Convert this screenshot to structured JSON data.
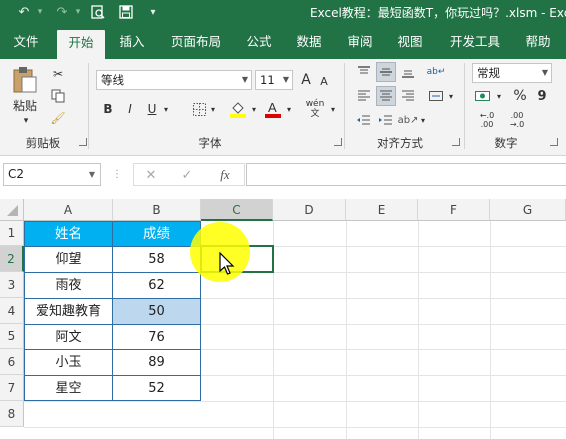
{
  "window": {
    "title": "Excel教程：最短函数T，你玩过吗？.xlsm - Exc"
  },
  "quick_access": {
    "undo": "↶",
    "redo": "↷",
    "print_preview": "⎙",
    "save": "💾",
    "more": "⌄"
  },
  "tabs": [
    "文件",
    "开始",
    "插入",
    "页面布局",
    "公式",
    "数据",
    "审阅",
    "视图",
    "开发工具",
    "帮助"
  ],
  "active_tab": "开始",
  "ribbon": {
    "clipboard": {
      "label": "剪贴板",
      "paste": "粘贴"
    },
    "font": {
      "label": "字体",
      "name": "等线",
      "size": "11",
      "bold": "B",
      "italic": "I",
      "underline": "U",
      "grow": "A",
      "shrink": "A",
      "wen": "wén\n文"
    },
    "align": {
      "label": "对齐方式"
    },
    "number": {
      "label": "数字",
      "format": "常规",
      "percent": "%",
      "comma": "9"
    }
  },
  "name_box": "C2",
  "formula_bar": {
    "cancel": "✕",
    "enter": "✓",
    "fx": "fx",
    "value": ""
  },
  "columns": [
    "A",
    "B",
    "C",
    "D",
    "E",
    "F",
    "G"
  ],
  "rows": [
    "1",
    "2",
    "3",
    "4",
    "5",
    "6",
    "7",
    "8"
  ],
  "table": {
    "headers": [
      "姓名",
      "成绩"
    ],
    "rows": [
      [
        "仰望",
        "58"
      ],
      [
        "雨夜",
        "62"
      ],
      [
        "爱知趣教育",
        "50"
      ],
      [
        "阿文",
        "76"
      ],
      [
        "小玉",
        "89"
      ],
      [
        "星空",
        "52"
      ]
    ]
  },
  "colors": {
    "excel_green": "#217346",
    "header_fill": "#00b0f0",
    "selected_fill": "#bdd7ee",
    "cursor_highlight": "#ffff00"
  }
}
